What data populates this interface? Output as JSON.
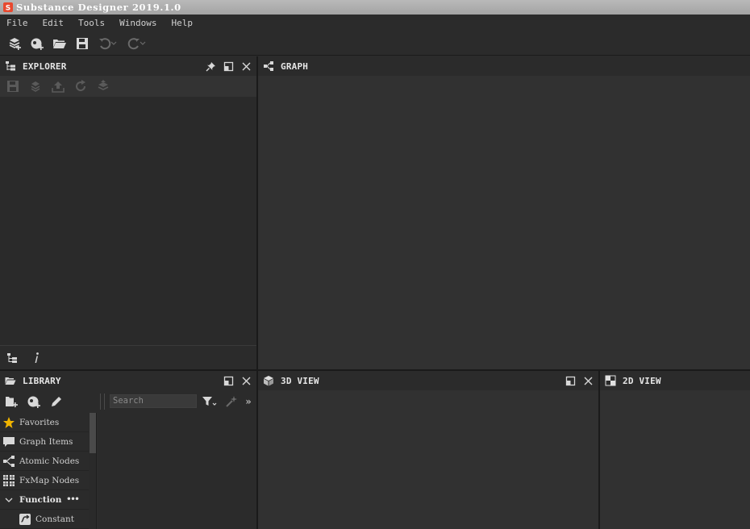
{
  "window": {
    "title": "Substance Designer 2019.1.0"
  },
  "menu": {
    "items": [
      "File",
      "Edit",
      "Tools",
      "Windows",
      "Help"
    ]
  },
  "panels": {
    "explorer": {
      "title": "EXPLORER"
    },
    "graph": {
      "title": "GRAPH"
    },
    "library": {
      "title": "LIBRARY",
      "search_placeholder": "Search"
    },
    "view3d": {
      "title": "3D VIEW"
    },
    "view2d": {
      "title": "2D VIEW"
    }
  },
  "library": {
    "categories": [
      {
        "label": "Favorites",
        "icon": "star-icon"
      },
      {
        "label": "Graph Items",
        "icon": "comment-icon"
      },
      {
        "label": "Atomic Nodes",
        "icon": "nodes-icon"
      },
      {
        "label": "FxMap Nodes",
        "icon": "grid-icon"
      },
      {
        "label": "Function",
        "icon": "chevron-down-icon",
        "section": true
      },
      {
        "label": "Constant",
        "icon": "constant-icon",
        "child": true
      }
    ]
  },
  "colors": {
    "accent_star": "#f0b400",
    "logo_red": "#e8492f",
    "panel_bg": "#313131",
    "header_bg": "#2b2b2b"
  }
}
